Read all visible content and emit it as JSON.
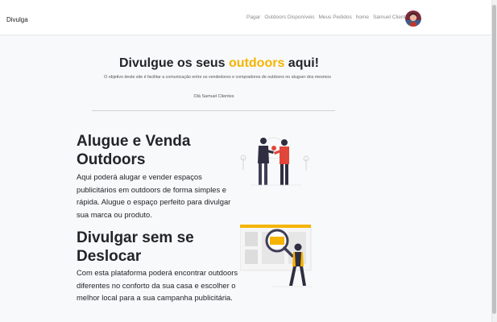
{
  "navbar": {
    "brand": "Divulga",
    "links": [
      "Pagar",
      "Outdoors Disponíveis",
      "Meus Pedidos",
      "home"
    ],
    "user_menu": "Samuel Clientes"
  },
  "hero": {
    "title_before": "Divulgue os seus ",
    "title_accent": "outdoors",
    "title_after": " aqui!",
    "subtitle": "O objetivo deste site é facilitar a comunicação entre os vendedores e compradores de outdoors no aluguer dos mesmos",
    "greeting": "Olá Samuel Clientes"
  },
  "sections": [
    {
      "title": "Alugue e Venda Outdoors",
      "text": "Aqui poderá alugar e vender espaços publicitários em outdoors de forma simples e rápida. Alugue o espaço perfeito para divulgar sua marca ou produto."
    },
    {
      "title": "Divulgar sem se Deslocar",
      "text": "Com esta plataforma poderá encontrar outdoors diferentes no conforto da sua casa e escolher o melhor local para a sua campanha publicitária."
    }
  ],
  "colors": {
    "accent": "#f5b400",
    "illustration_red": "#e0463a",
    "illustration_dark": "#2f2e41"
  },
  "icons": {
    "user_avatar": "avatar",
    "dropdown": "caret-down-icon",
    "illustration_1": "handshake-illustration",
    "illustration_2": "magnifier-billboard-illustration"
  }
}
